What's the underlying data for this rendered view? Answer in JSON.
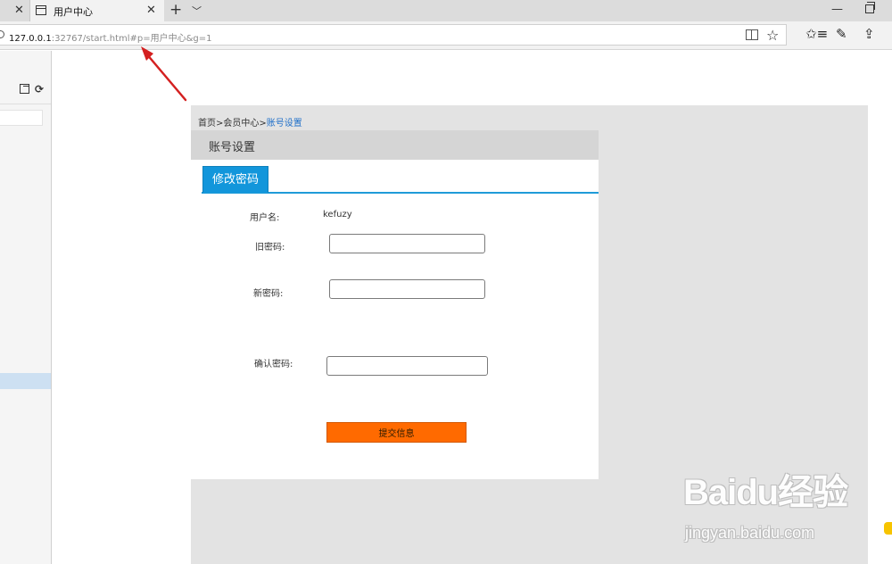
{
  "browser": {
    "tab_title": "用户中心",
    "url_host": "127.0.0.1",
    "url_rest": ":32767/start.html#p=用户中心&g=1",
    "icons": [
      "close-icon",
      "page-icon",
      "plus-icon",
      "chevron-down-icon",
      "minimize-icon",
      "restore-icon",
      "reading-view-icon",
      "star-icon",
      "favorites-icon",
      "pen-icon",
      "share-icon"
    ]
  },
  "breadcrumb": {
    "home": "首页",
    "sep1": ">",
    "member": "会员中心",
    "sep2": ">",
    "current": "账号设置"
  },
  "panel": {
    "title": "账号设置",
    "tab_label": "修改密码"
  },
  "form": {
    "username_label": "用户名:",
    "username_value": "kefuzy",
    "old_password_label": "旧密码:",
    "new_password_label": "新密码:",
    "confirm_password_label": "确认密码:",
    "old_password_value": "",
    "new_password_value": "",
    "confirm_password_value": "",
    "submit_label": "提交信息"
  },
  "watermark": {
    "logo": "Baidu经验",
    "sub": "jingyan.baidu.com"
  },
  "colors": {
    "tab_blue": "#1296db",
    "submit_orange": "#ff6a00",
    "breadcrumb_current": "#1f6fc9",
    "annotation_red": "#d42020"
  }
}
